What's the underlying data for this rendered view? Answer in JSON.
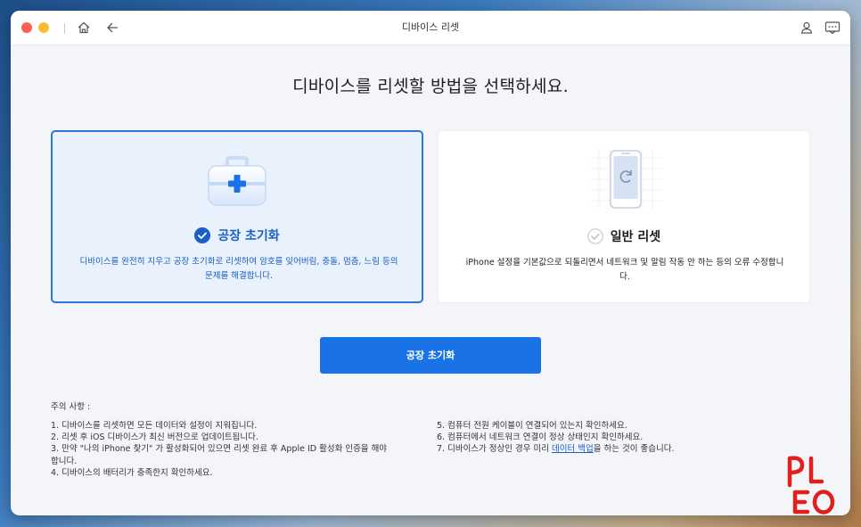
{
  "window": {
    "title": "디바이스 리셋"
  },
  "icons": {
    "home": "home-icon",
    "back": "back-arrow-icon",
    "user": "user-icon",
    "feedback": "feedback-icon"
  },
  "heading": "디바이스를 리셋할 방법을 선택하세요.",
  "options": [
    {
      "title": "공장 초기화",
      "description": "디바이스를 완전히 지우고 공장 초기화로 리셋하여 암호를 잊어버림, 충돌, 멈춤, 느림 등의 문제를 해결합니다.",
      "selected": true
    },
    {
      "title": "일반 리셋",
      "description": "iPhone 설정을 기본값으로 되돌리면서 네트워크 및 알림 작동 안 하는 등의 오류 수정합니다.",
      "selected": false
    }
  ],
  "cta_label": "공장 초기화",
  "notes": {
    "title": "주의 사항 :",
    "left": [
      "1. 디바이스를 리셋하면 모든 데이터와 설정이 지워집니다.",
      "2. 리셋 후 iOS 디바이스가 최신 버전으로 업데이트됩니다.",
      "3. 만약 \"나의 iPhone 찾기\" 가 활성화되어 있으면 리셋 완료 후 Apple ID 활성화 인증을 해야 합니다.",
      "4. 디바이스의 배터리가 충족한지 확인하세요."
    ],
    "right": [
      "5. 컴퓨터 전원 케이블이 연결되어 있는지 확인하세요.",
      "6. 컴퓨터에서 네트워크 연결이 정상 상태인지 확인하세요."
    ],
    "right_7_prefix": "7. 디바이스가 정상인 경우 미리 ",
    "right_7_link": "데이터 백업",
    "right_7_suffix": "을 하는 것이 좋습니다."
  },
  "colors": {
    "accent": "#1a73e6",
    "selected_border": "#2c74d8",
    "selected_bg": "#e9f1fc",
    "logo_red": "#e0201c"
  },
  "logo_text": "PLEO"
}
